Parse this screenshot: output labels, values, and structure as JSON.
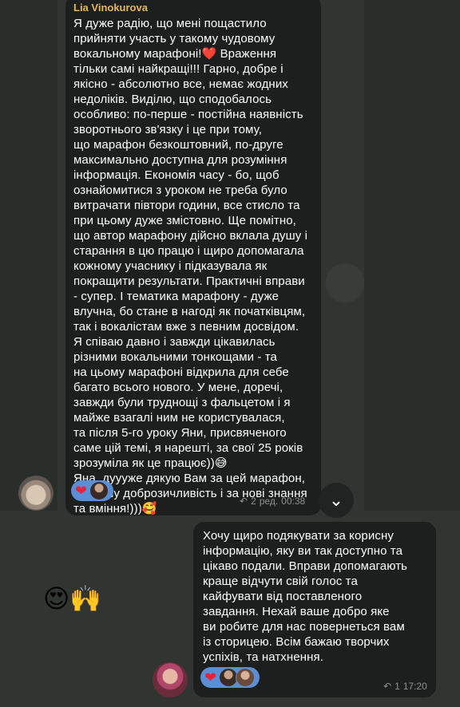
{
  "message1": {
    "author": "Lia Vinokurova",
    "text": "Я дуже радію, що мені пощастило\nприйняти участь у такому чудовому\nвокальному марафоні!❤️ Враження\nтільки самі найкращі!!! Гарно, добре і\nякісно - абсолютно все, немає жодних\nнедоліків. Виділю, що сподобалось\nособливо: по-перше - постійна наявність\nзворотнього зв'язку і це при тому,\nщо марафон безкоштовний, по-друге\nмаксимально доступна для розуміння\nінформація. Економія часу - бо, щоб\nознайомитися з уроком не треба було\nвитрачати півтори години, все стисло та\nпри цьому дуже змістовно. Ще помітно,\nщо автор марафону дійсно вклала душу і\nстарання в цю працю і щиро допомагала\nкожному учаснику і підказувала як\nпокращити результати. Практичні вправи\n- супер. І тематика марафону - дуже\nвлучна, бо стане в нагоді як початківцям,\nтак і вокалістам вже з певним досвідом.\nЯ співаю давно і завжди цікавилась\nрізними вокальними тонкощами - та\nна цьому марафоні відкрила для себе\nбагато всього нового. У мене, доречі,\nзавжди були труднощі з фальцетом і я\nмайже взагалі ним не користувалася,\nта після 5-го уроку Яни, присвяченого\nсаме цій темі, я нарешті, за свої  25 років\nзрозуміла як це працює))😅\nЯна, дуууже дякую Вам за цей марафон,\nза Вашу доброзичливість і за нові знання\nта вміння!)))🥰",
    "reaction_heart": "❤",
    "replies": "2",
    "edited_label": "ред.",
    "time": "00:38"
  },
  "message2": {
    "text": "Хочу щиро подякувати за корисну\nінформацію, яку ви так доступно та\nцікаво подали. Вправи допомагають\nкраще відчути свій голос та\nкайфувати від поставленого\nзавдання. Нехай ваше добро яке\nви робите для нас повернеться вам\nіз сторицею. Всім бажаю творчих\nуспіхів, та натхнення.",
    "reaction_heart": "❤",
    "replies": "1",
    "time": "17:20"
  },
  "sticker": "😍🙌",
  "icons": {
    "reply": "↶",
    "scroll_down": "⌄"
  },
  "colors": {
    "author": "#e6b85c",
    "reaction_bg": "#5a8fd6",
    "bubble": "#1c1f1d"
  }
}
